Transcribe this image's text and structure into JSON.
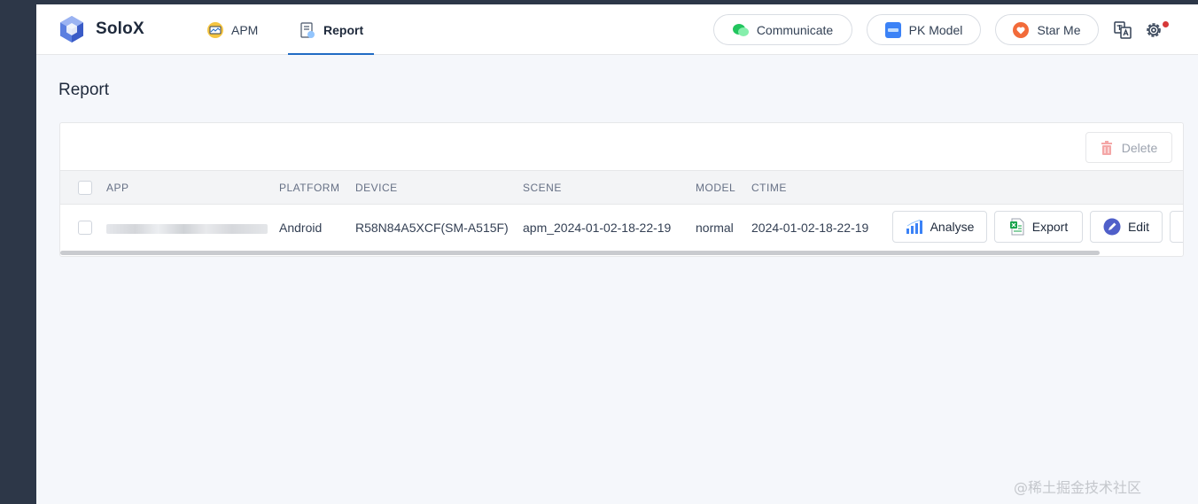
{
  "app": {
    "name": "SoloX"
  },
  "nav": {
    "tabs": [
      {
        "label": "APM",
        "active": false
      },
      {
        "label": "Report",
        "active": true
      }
    ]
  },
  "header_actions": {
    "communicate": "Communicate",
    "pk_model": "PK Model",
    "star_me": "Star Me"
  },
  "page": {
    "title": "Report"
  },
  "toolbar": {
    "delete_label": "Delete"
  },
  "table": {
    "columns": [
      "APP",
      "PLATFORM",
      "DEVICE",
      "SCENE",
      "MODEL",
      "CTIME"
    ],
    "rows": [
      {
        "app": "",
        "platform": "Android",
        "device": "R58N84A5XCF(SM-A515F)",
        "scene": "apm_2024-01-02-18-22-19",
        "model": "normal",
        "ctime": "2024-01-02-18-22-19"
      }
    ],
    "row_actions": {
      "analyse": "Analyse",
      "export": "Export",
      "edit": "Edit"
    }
  },
  "watermark": "@稀土掘金技术社区",
  "colors": {
    "accent": "#206bc4",
    "danger": "#d63939",
    "sidebar_bg": "#2d3748"
  }
}
